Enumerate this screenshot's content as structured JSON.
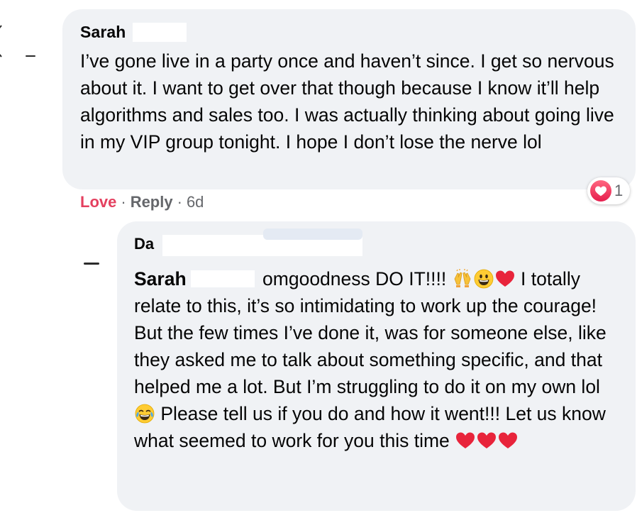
{
  "comment": {
    "author": "Sarah",
    "text": "I’ve gone live in a party once and haven’t since. I get so nervous about it. I want to get over that though because I know it’ll help algorithms and sales too. I was actually thinking about going live in my VIP group tonight. I hope I don’t lose the nerve lol",
    "actions": {
      "love": "Love",
      "separator": "·",
      "reply": "Reply",
      "time": "6d"
    },
    "reactions": {
      "icon": "heart-reaction-icon",
      "count": "1"
    }
  },
  "reply": {
    "author": "Da",
    "mention": "Sarah",
    "text_1": "omgoodness DO IT!!!!",
    "text_2": "I totally relate to this, it’s so intimidating to work up the courage! But the few times I’ve done it, was for someone else, like they asked me to talk about something specific, and that helped me a lot. But I’m struggling to do it on my own lol",
    "text_3": "Please tell us if you do and how it went!!! Let us know what seemed to work for you this time",
    "emojis": [
      "raising-hands-emoji",
      "grinning-face-emoji",
      "red-heart-emoji",
      "tears-of-joy-emoji",
      "red-heart-emoji",
      "red-heart-emoji",
      "red-heart-emoji"
    ]
  },
  "colors": {
    "bubble": "#f0f2f5",
    "love_action": "#e4405f",
    "meta_text": "#65676b",
    "heart": "#e8243b"
  }
}
